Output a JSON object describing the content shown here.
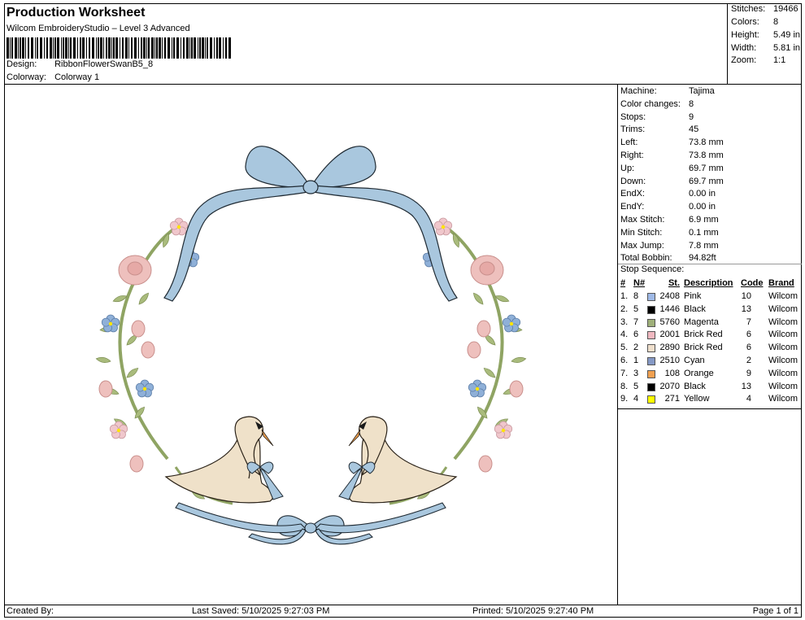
{
  "header": {
    "title": "Production Worksheet",
    "subtitle": "Wilcom EmbroideryStudio – Level 3 Advanced",
    "design_label": "Design:",
    "design_value": "RibbonFlowerSwanB5_8",
    "colorway_label": "Colorway:",
    "colorway_value": "Colorway 1"
  },
  "summary": [
    {
      "label": "Stitches:",
      "value": "19466"
    },
    {
      "label": "Colors:",
      "value": "8"
    },
    {
      "label": "Height:",
      "value": "5.49 in"
    },
    {
      "label": "Width:",
      "value": "5.81 in"
    },
    {
      "label": "Zoom:",
      "value": "1:1"
    }
  ],
  "machine_info": [
    {
      "label": "Machine:",
      "value": "Tajima"
    },
    {
      "label": "Color changes:",
      "value": "8"
    },
    {
      "label": "Stops:",
      "value": "9"
    },
    {
      "label": "Trims:",
      "value": "45"
    },
    {
      "label": "Left:",
      "value": "73.8 mm"
    },
    {
      "label": "Right:",
      "value": "73.8 mm"
    },
    {
      "label": "Up:",
      "value": "69.7 mm"
    },
    {
      "label": "Down:",
      "value": "69.7 mm"
    },
    {
      "label": "EndX:",
      "value": "0.00 in"
    },
    {
      "label": "EndY:",
      "value": "0.00 in"
    },
    {
      "label": "Max Stitch:",
      "value": "6.9 mm"
    },
    {
      "label": "Min Stitch:",
      "value": "0.1 mm"
    },
    {
      "label": "Max Jump:",
      "value": "7.8 mm"
    },
    {
      "label": "Total Bobbin:",
      "value": "94.82ft"
    }
  ],
  "stop_sequence": {
    "title": "Stop Sequence:",
    "headers": {
      "idx": "#",
      "n": "N#",
      "st": "St.",
      "desc": "Description",
      "code": "Code",
      "brand": "Brand"
    },
    "rows": [
      {
        "idx": "1.",
        "n": "8",
        "color": "#9fb9e6",
        "st": "2408",
        "desc": "Pink",
        "code": "10",
        "brand": "Wilcom"
      },
      {
        "idx": "2.",
        "n": "5",
        "color": "#000000",
        "st": "1446",
        "desc": "Black",
        "code": "13",
        "brand": "Wilcom"
      },
      {
        "idx": "3.",
        "n": "7",
        "color": "#9fb07a",
        "st": "5760",
        "desc": "Magenta",
        "code": "7",
        "brand": "Wilcom"
      },
      {
        "idx": "4.",
        "n": "6",
        "color": "#f0b8c0",
        "st": "2001",
        "desc": "Brick Red",
        "code": "6",
        "brand": "Wilcom"
      },
      {
        "idx": "5.",
        "n": "2",
        "color": "#efdfcc",
        "st": "2890",
        "desc": "Brick Red",
        "code": "6",
        "brand": "Wilcom"
      },
      {
        "idx": "6.",
        "n": "1",
        "color": "#8599c5",
        "st": "2510",
        "desc": "Cyan",
        "code": "2",
        "brand": "Wilcom"
      },
      {
        "idx": "7.",
        "n": "3",
        "color": "#f0a050",
        "st": "108",
        "desc": "Orange",
        "code": "9",
        "brand": "Wilcom"
      },
      {
        "idx": "8.",
        "n": "5",
        "color": "#000000",
        "st": "2070",
        "desc": "Black",
        "code": "13",
        "brand": "Wilcom"
      },
      {
        "idx": "9.",
        "n": "4",
        "color": "#ffff00",
        "st": "271",
        "desc": "Yellow",
        "code": "4",
        "brand": "Wilcom"
      }
    ]
  },
  "footer": {
    "created_by": "Created By:",
    "last_saved": "Last Saved: 5/10/2025 9:27:03 PM",
    "printed": "Printed: 5/10/2025 9:27:40 PM",
    "page": "Page 1 of 1"
  },
  "colors": {
    "ribbon": "#a9c7de",
    "ribbon_dark": "#6f95b5",
    "leaf": "#a9bb7c",
    "rose": "#eec0bd",
    "swan": "#efe1c9",
    "beak": "#f0a050"
  }
}
